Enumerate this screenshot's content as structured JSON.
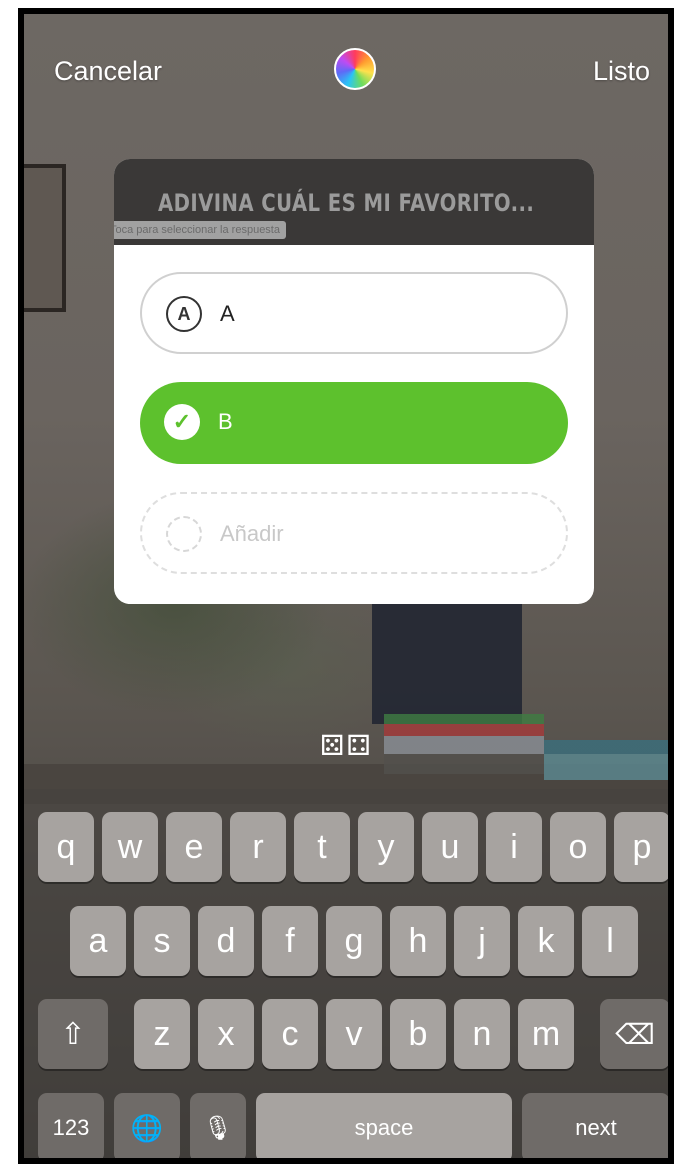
{
  "topbar": {
    "cancel_label": "Cancelar",
    "done_label": "Listo",
    "color_picker_icon": "color-wheel-icon"
  },
  "quiz": {
    "title": "ADIVINA CUÁL ES MI FAVORITO...",
    "hint": "Toca para seleccionar la respuesta",
    "options": [
      {
        "marker": "A",
        "label": "A",
        "selected": false
      },
      {
        "marker": "✓",
        "label": "B",
        "selected": true
      },
      {
        "marker": "",
        "label": "Añadir",
        "placeholder": true
      }
    ],
    "selected_color": "#5dc12d"
  },
  "keyboard": {
    "row1": [
      "q",
      "w",
      "e",
      "r",
      "t",
      "y",
      "u",
      "i",
      "o",
      "p"
    ],
    "row2": [
      "a",
      "s",
      "d",
      "f",
      "g",
      "h",
      "j",
      "k",
      "l"
    ],
    "row3": [
      "z",
      "x",
      "c",
      "v",
      "b",
      "n",
      "m"
    ],
    "shift_icon": "⇧",
    "backspace_icon": "⌫",
    "numbers_label": "123",
    "globe_icon": "🌐",
    "mic_icon": "🎙",
    "space_label": "space",
    "next_label": "next"
  }
}
